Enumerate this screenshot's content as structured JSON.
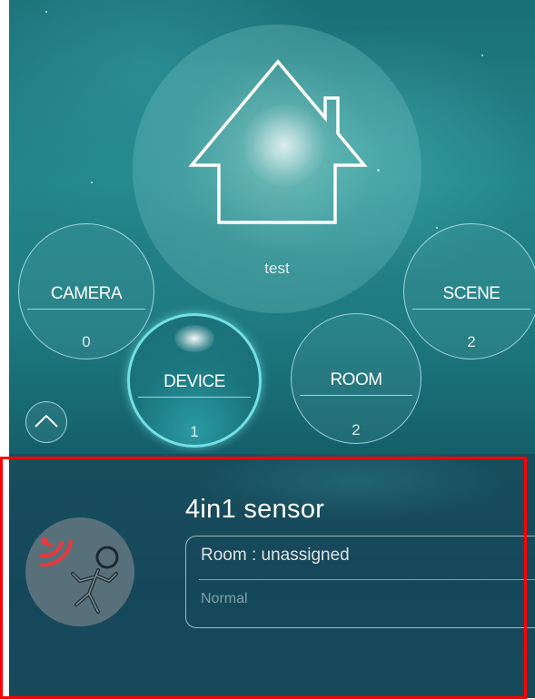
{
  "home": {
    "name": "test",
    "icon": "house-icon"
  },
  "categories": {
    "camera": {
      "label": "CAMERA",
      "count": "0"
    },
    "device": {
      "label": "DEVICE",
      "count": "1"
    },
    "room": {
      "label": "ROOM",
      "count": "2"
    },
    "scene": {
      "label": "SCENE",
      "count": "2"
    }
  },
  "collapse_icon": "chevron-up-icon",
  "device_card": {
    "name": "4in1 sensor",
    "room": "Room : unassigned",
    "status": "Normal",
    "icon": "motion-sensor-icon"
  },
  "colors": {
    "accent": "#7fe6ea",
    "highlight_border": "#ff0000",
    "signal_red": "#e8383d"
  }
}
